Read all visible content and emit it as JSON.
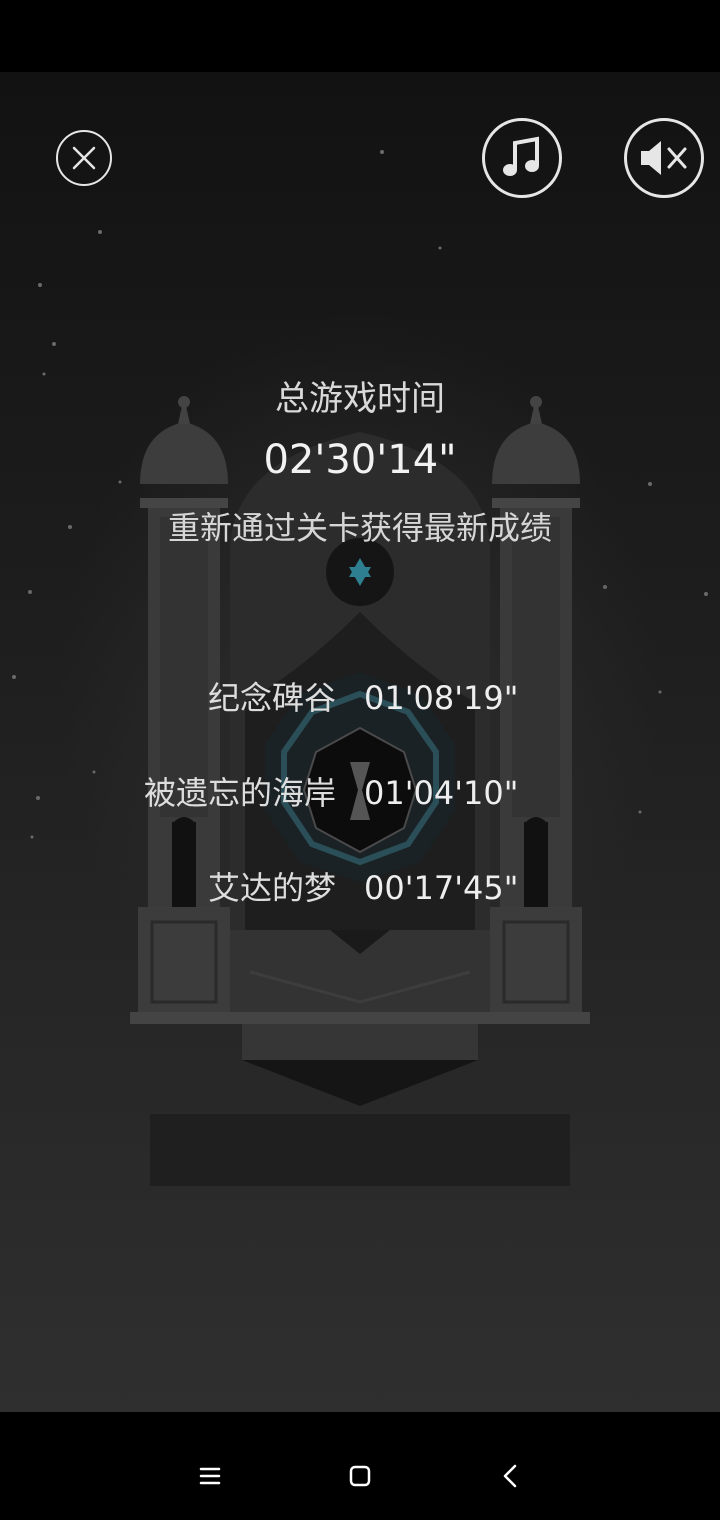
{
  "controls": {
    "close_icon": "close-circle-icon",
    "music_icon": "music-note-icon",
    "sound_icon": "speaker-muted-icon"
  },
  "summary": {
    "title": "总游戏时间",
    "total_time": "02'30'14\"",
    "hint": "重新通过关卡获得最新成绩"
  },
  "levels": [
    {
      "name": "纪念碑谷",
      "time": "01'08'19\""
    },
    {
      "name": "被遗忘的海岸",
      "time": "01'04'10\""
    },
    {
      "name": "艾达的梦",
      "time": "00'17'45\""
    }
  ],
  "navigation": {
    "menu_icon": "menu-lines-icon",
    "home_icon": "home-square-icon",
    "back_icon": "back-chevron-icon"
  },
  "colors": {
    "background_top": "#121212",
    "background_bottom": "#2f2f2f",
    "text": "#e4e4e4",
    "temple_stone": "#3a3a3a",
    "accent_teal": "#2e7f8f"
  }
}
